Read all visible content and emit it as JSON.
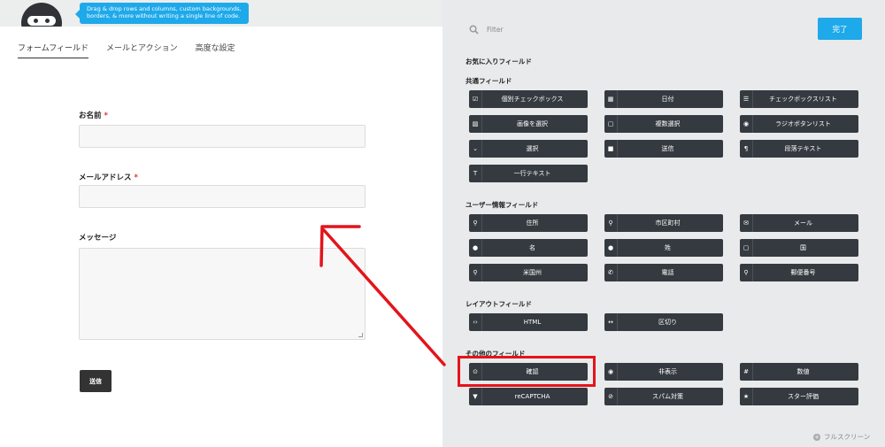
{
  "promo": {
    "text": "Drag & drop rows and columns, custom backgrounds, borders, & more without writing a single line of code."
  },
  "tabs": [
    {
      "label": "フォームフィールド",
      "active": true
    },
    {
      "label": "メールとアクション",
      "active": false
    },
    {
      "label": "高度な設定",
      "active": false
    }
  ],
  "form": {
    "name_label": "お名前",
    "email_label": "メールアドレス",
    "message_label": "メッセージ",
    "required_mark": "*",
    "submit_label": "送信"
  },
  "drawer": {
    "filter_placeholder": "Filter",
    "done_label": "完了",
    "fullscreen_label": "フルスクリーン",
    "sections": {
      "favorites": "お気に入りフィールド",
      "common": "共通フィールド",
      "user_info": "ユーザー情報フィールド",
      "layout": "レイアウトフィールド",
      "other": "その他のフィールド"
    },
    "common_fields": [
      {
        "label": "個別チェックボックス",
        "icon": "checkbox-icon"
      },
      {
        "label": "日付",
        "icon": "calendar-icon"
      },
      {
        "label": "チェックボックスリスト",
        "icon": "list-icon"
      },
      {
        "label": "画像を選択",
        "icon": "image-icon"
      },
      {
        "label": "複数選択",
        "icon": "square-icon"
      },
      {
        "label": "ラジオボタンリスト",
        "icon": "radio-icon"
      },
      {
        "label": "選択",
        "icon": "chevron-down-icon"
      },
      {
        "label": "送信",
        "icon": "stop-icon"
      },
      {
        "label": "段落テキスト",
        "icon": "paragraph-icon"
      },
      {
        "label": "一行テキスト",
        "icon": "text-icon"
      }
    ],
    "user_fields": [
      {
        "label": "住所",
        "icon": "map-marker-icon"
      },
      {
        "label": "市区町村",
        "icon": "map-marker-icon"
      },
      {
        "label": "メール",
        "icon": "envelope-icon"
      },
      {
        "label": "名",
        "icon": "user-icon"
      },
      {
        "label": "姓",
        "icon": "user-icon"
      },
      {
        "label": "国",
        "icon": "square-icon"
      },
      {
        "label": "米国州",
        "icon": "map-marker-icon"
      },
      {
        "label": "電話",
        "icon": "phone-icon"
      },
      {
        "label": "郵便番号",
        "icon": "map-marker-icon"
      }
    ],
    "layout_fields": [
      {
        "label": "HTML",
        "icon": "code-icon"
      },
      {
        "label": "区切り",
        "icon": "divider-icon"
      }
    ],
    "other_fields": [
      {
        "label": "確認",
        "icon": "check-circle-icon"
      },
      {
        "label": "非表示",
        "icon": "eye-slash-icon"
      },
      {
        "label": "数値",
        "icon": "hash-icon"
      },
      {
        "label": "reCAPTCHA",
        "icon": "filter-icon"
      },
      {
        "label": "スパム対策",
        "icon": "ban-icon"
      },
      {
        "label": "スター評価",
        "icon": "star-icon"
      }
    ]
  },
  "colors": {
    "accent": "#1ea9ea",
    "button_dark": "#343a40",
    "annotation_red": "#e3141b"
  }
}
